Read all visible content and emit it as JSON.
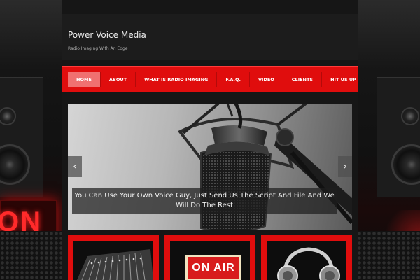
{
  "site": {
    "title": "Power Voice Media",
    "tagline": "Radio Imaging With An Edge"
  },
  "nav": {
    "items": [
      {
        "label": "HOME",
        "active": true
      },
      {
        "label": "ABOUT",
        "active": false
      },
      {
        "label": "WHAT IS RADIO IMAGING",
        "active": false
      },
      {
        "label": "F.A.Q.",
        "active": false
      },
      {
        "label": "VIDEO",
        "active": false
      },
      {
        "label": "CLIENTS",
        "active": false
      },
      {
        "label": "HIT US UP",
        "active": false
      }
    ]
  },
  "slider": {
    "caption": "You Can Use Your Own Voice Guy, Just Send Us The Script And File And We Will Do The Rest",
    "prev_icon": "chevron-left-icon",
    "next_icon": "chevron-right-icon"
  },
  "decor": {
    "side_sign": "ON AIR",
    "tile_sign": "ON AIR"
  },
  "colors": {
    "accent": "#e00d0d",
    "nav_active": "#f07070",
    "background": "#161616"
  }
}
